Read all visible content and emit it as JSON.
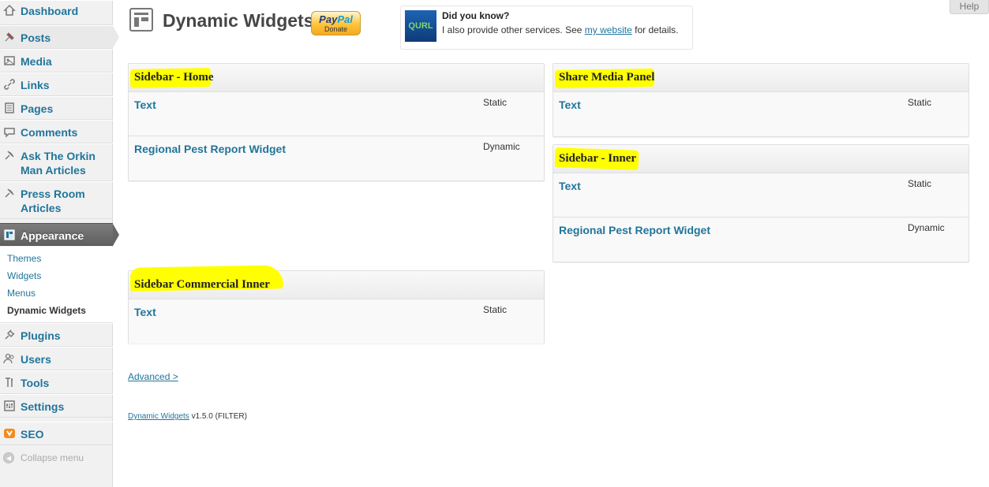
{
  "menu": {
    "dashboard": "Dashboard",
    "posts": "Posts",
    "media": "Media",
    "links": "Links",
    "pages": "Pages",
    "comments": "Comments",
    "ask_orkin": "Ask The Orkin Man Articles",
    "press_room": "Press Room Articles",
    "appearance": "Appearance",
    "submenu": {
      "themes": "Themes",
      "widgets": "Widgets",
      "menus": "Menus",
      "dynamic_widgets": "Dynamic Widgets"
    },
    "plugins": "Plugins",
    "users": "Users",
    "tools": "Tools",
    "settings": "Settings",
    "seo": "SEO",
    "collapse": "Collapse menu"
  },
  "header": {
    "title": "Dynamic Widgets",
    "paypal_brand_a": "Pay",
    "paypal_brand_b": "Pal",
    "paypal_donate": "Donate",
    "help": "Help"
  },
  "notice": {
    "logo_text": "QURL",
    "title": "Did you know?",
    "text_before": "I also provide other services. See ",
    "link": "my website",
    "text_after": " for details."
  },
  "panels": {
    "sidebar_home": {
      "title": "Sidebar - Home",
      "widgets": [
        {
          "name": "Text",
          "type": "Static"
        },
        {
          "name": "Regional Pest Report Widget",
          "type": "Dynamic"
        }
      ]
    },
    "share_media": {
      "title": "Share Media Panel",
      "widgets": [
        {
          "name": "Text",
          "type": "Static"
        }
      ]
    },
    "sidebar_inner": {
      "title": "Sidebar - Inner",
      "widgets": [
        {
          "name": "Text",
          "type": "Static"
        },
        {
          "name": "Regional Pest Report Widget",
          "type": "Dynamic"
        }
      ]
    },
    "sidebar_commercial_inner": {
      "title": "Sidebar Commercial Inner",
      "widgets": [
        {
          "name": "Text",
          "type": "Static"
        }
      ]
    }
  },
  "advanced_link": "Advanced >",
  "footer": {
    "link": "Dynamic Widgets",
    "version": " v1.5.0 (FILTER)"
  },
  "colors": {
    "link_blue": "#21759b",
    "highlight": "#ffff00",
    "current_menu": "#6d6d6d"
  },
  "icons": [
    "dashboard-icon",
    "posts-icon",
    "media-icon",
    "links-icon",
    "pages-icon",
    "comments-icon",
    "pin-icon",
    "appearance-icon",
    "plugins-icon",
    "users-icon",
    "tools-icon",
    "settings-icon",
    "seo-icon",
    "collapse-icon",
    "page-icon"
  ]
}
